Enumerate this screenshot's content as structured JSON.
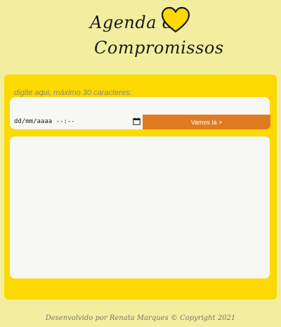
{
  "header": {
    "title_line1": "Agenda de",
    "title_line2": "Compromissos",
    "heart_color": "#fcd900"
  },
  "form": {
    "task_placeholder": "digite aqui, máximo 30 caracteres:",
    "datetime_value": "dd/mm/aaaa --:--",
    "submit_label": "Vamos lá >"
  },
  "list": {
    "items": []
  },
  "footer": {
    "text": "Desenvolvido por Renata Marques © Copyright 2021"
  },
  "colors": {
    "background": "#f3ee9f",
    "card": "#fcd900",
    "button": "#e07b22",
    "panel": "#f7f7f6"
  }
}
